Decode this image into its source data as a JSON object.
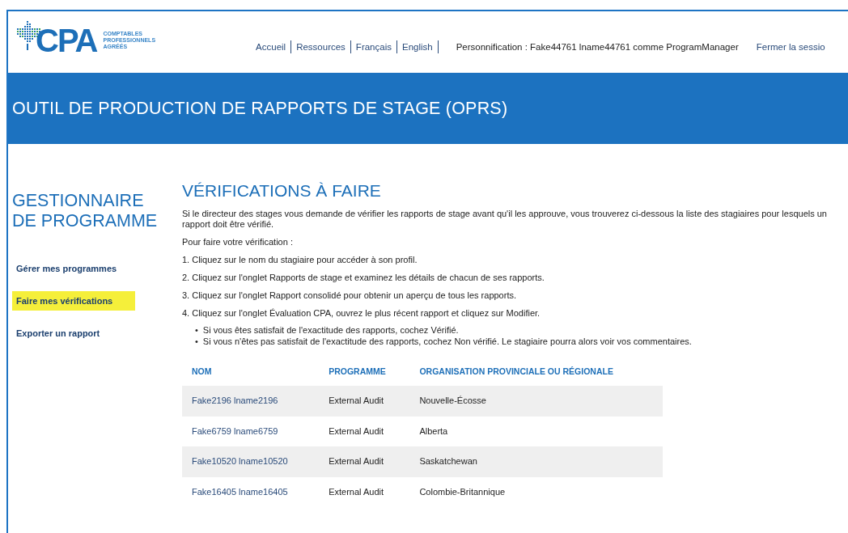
{
  "header": {
    "logo": {
      "mark": "CPA",
      "tagline": [
        "COMPTABLES",
        "PROFESSIONNELS",
        "AGRÉÉS"
      ]
    },
    "nav": [
      {
        "label": "Accueil"
      },
      {
        "label": "Ressources"
      },
      {
        "label": "Français"
      },
      {
        "label": "English"
      }
    ],
    "impersonation": "Personnification : Fake44761 lname44761 comme ProgramManager",
    "logout": "Fermer la sessio"
  },
  "banner": {
    "title": "OUTIL DE PRODUCTION DE RAPPORTS DE STAGE (OPRS)"
  },
  "sidebar": {
    "title": "GESTIONNAIRE DE PROGRAMME",
    "items": [
      {
        "label": "Gérer mes programmes",
        "selected": false
      },
      {
        "label": "Faire mes vérifications",
        "selected": true
      },
      {
        "label": "Exporter un rapport",
        "selected": false
      }
    ]
  },
  "main": {
    "title": "VÉRIFICATIONS À FAIRE",
    "intro": "Si le directeur des stages vous demande de vérifier les rapports de stage avant qu'il les approuve, vous trouverez ci-dessous la liste des stagiaires pour lesquels un rapport doit être vérifié.",
    "lead": "Pour faire votre vérification :",
    "steps": [
      "1. Cliquez sur le nom du stagiaire pour accéder à son profil.",
      "2. Cliquez sur l'onglet Rapports de stage et examinez les détails de chacun de ses rapports.",
      "3. Cliquez sur l'onglet Rapport consolidé pour obtenir un aperçu de tous les rapports.",
      "4. Cliquez sur l'onglet Évaluation CPA, ouvrez le plus récent rapport et cliquez sur Modifier."
    ],
    "bullets": [
      {
        "marker": "•",
        "text": "Si vous êtes satisfait de l'exactitude des rapports, cochez Vérifié."
      },
      {
        "marker": "•",
        "text": "Si vous n'êtes pas satisfait de l'exactitude des rapports, cochez Non vérifié. Le stagiaire pourra alors voir vos commentaires."
      }
    ],
    "table": {
      "columns": [
        "NOM",
        "PROGRAMME",
        "ORGANISATION PROVINCIALE OU RÉGIONALE"
      ],
      "rows": [
        [
          "Fake2196 lname2196",
          "External Audit",
          "Nouvelle-Écosse"
        ],
        [
          "Fake6759 lname6759",
          "External Audit",
          "Alberta"
        ],
        [
          "Fake10520 lname10520",
          "External Audit",
          "Saskatchewan"
        ],
        [
          "Fake16405 lname16405",
          "External Audit",
          "Colombie-Britannique"
        ]
      ]
    }
  }
}
